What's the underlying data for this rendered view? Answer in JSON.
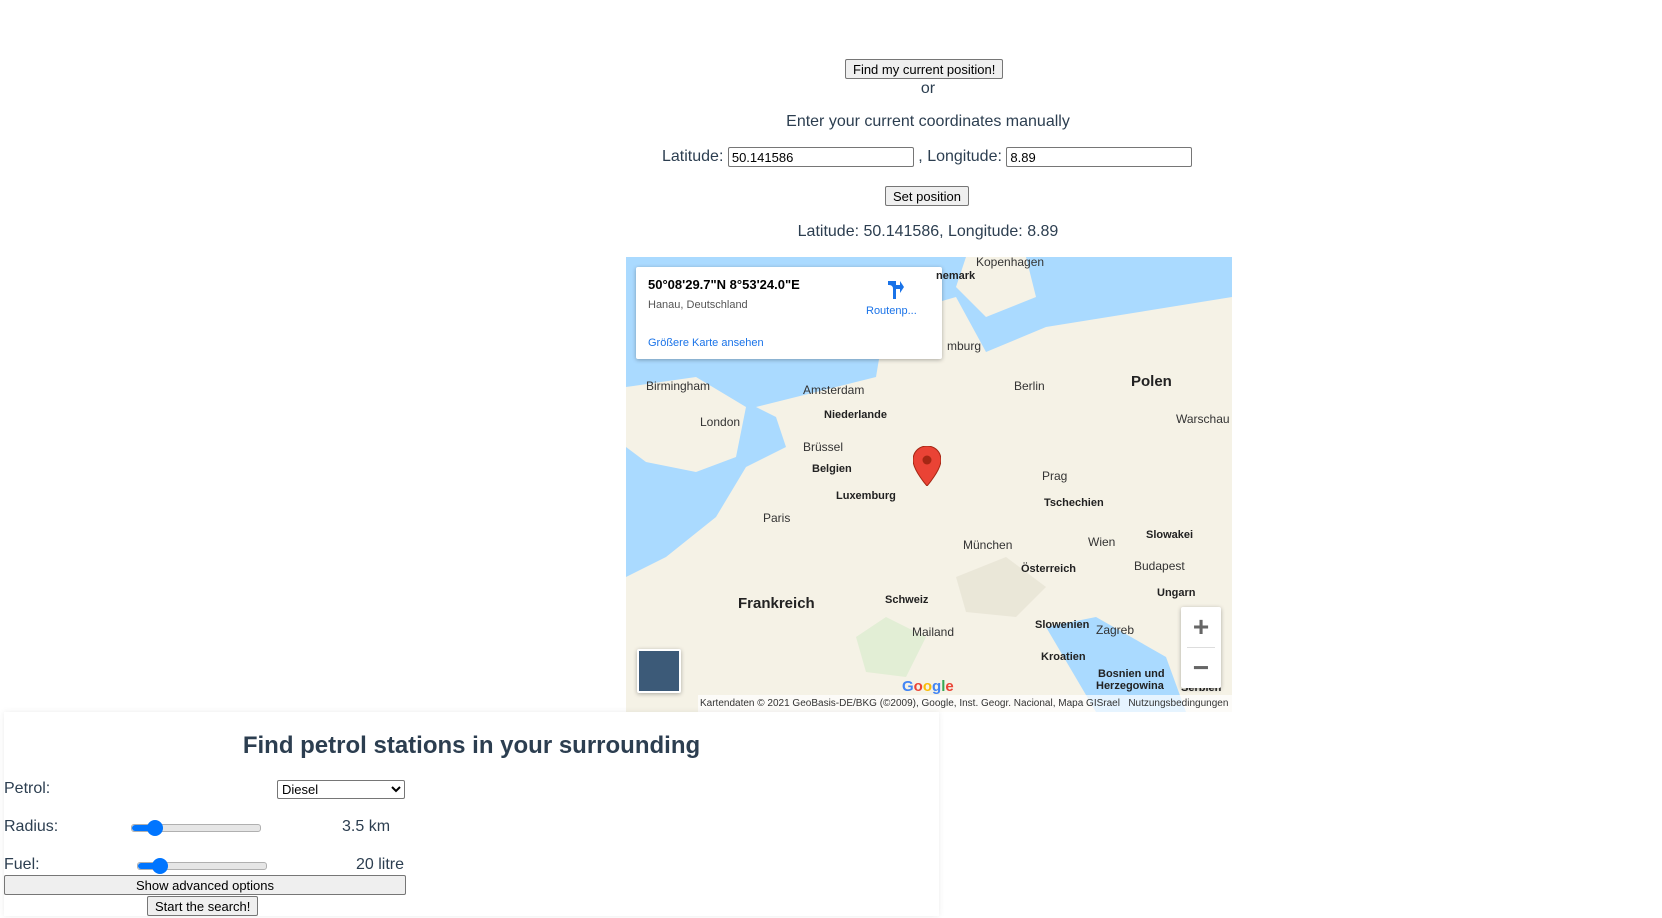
{
  "position_form": {
    "find_button": "Find my current position!",
    "or_text": "or",
    "manual_heading": "Enter your current coordinates manually",
    "latitude_label": "Latitude:",
    "longitude_label": ", Longitude:",
    "latitude_value": "50.141586",
    "longitude_value": "8.89",
    "set_button": "Set position",
    "current_position": "Latitude: 50.141586, Longitude: 8.89"
  },
  "map": {
    "info_title": "50°08'29.7\"N 8°53'24.0\"E",
    "info_place": "Hanau, Deutschland",
    "route_label": "Routenp...",
    "larger_map_link": "Größere Karte ansehen",
    "zoom_in": "+",
    "zoom_out": "−",
    "google_logo": "Google",
    "attribution": "Kartendaten © 2021 GeoBasis-DE/BKG (©2009), Google, Inst. Geogr. Nacional, Mapa GISrael",
    "terms": "Nutzungsbedingungen",
    "labels": {
      "kopenhagen": "Kopenhagen",
      "danemark": "nemark",
      "hamburg": "mburg",
      "birmingham": "Birmingham",
      "amsterdam": "Amsterdam",
      "niederlande": "Niederlande",
      "berlin": "Berlin",
      "polen": "Polen",
      "warschau": "Warschau",
      "london": "London",
      "brussel": "Brüssel",
      "belgien": "Belgien",
      "luxemburg": "Luxemburg",
      "prag": "Prag",
      "tschechien": "Tschechien",
      "paris": "Paris",
      "munchen": "München",
      "wien": "Wien",
      "slowakei": "Slowakei",
      "budapest": "Budapest",
      "osterreich": "Österreich",
      "ungarn": "Ungarn",
      "frankreich": "Frankreich",
      "schweiz": "Schweiz",
      "slowenien": "Slowenien",
      "zagreb": "Zagreb",
      "mailand": "Mailand",
      "kroatien": "Kroatien",
      "bosnien": "Bosnien und",
      "herzegowina": "Herzegowina",
      "serbien": "Serbien"
    },
    "colors": {
      "water": "#aadaff",
      "land": "#f5f2e6",
      "marker": "#ea4335",
      "link": "#1a73e8"
    }
  },
  "search_panel": {
    "title": "Find petrol stations in your surrounding",
    "petrol_label": "Petrol:",
    "petrol_selected": "Diesel",
    "radius_label": "Radius:",
    "radius_value": "3.5 km",
    "radius_fraction": 0.18,
    "fuel_label": "Fuel:",
    "fuel_value": "20 litre",
    "fuel_fraction": 0.17,
    "advanced_button": "Show advanced options",
    "start_button": "Start the search!",
    "accent_color": "#0075ff"
  }
}
